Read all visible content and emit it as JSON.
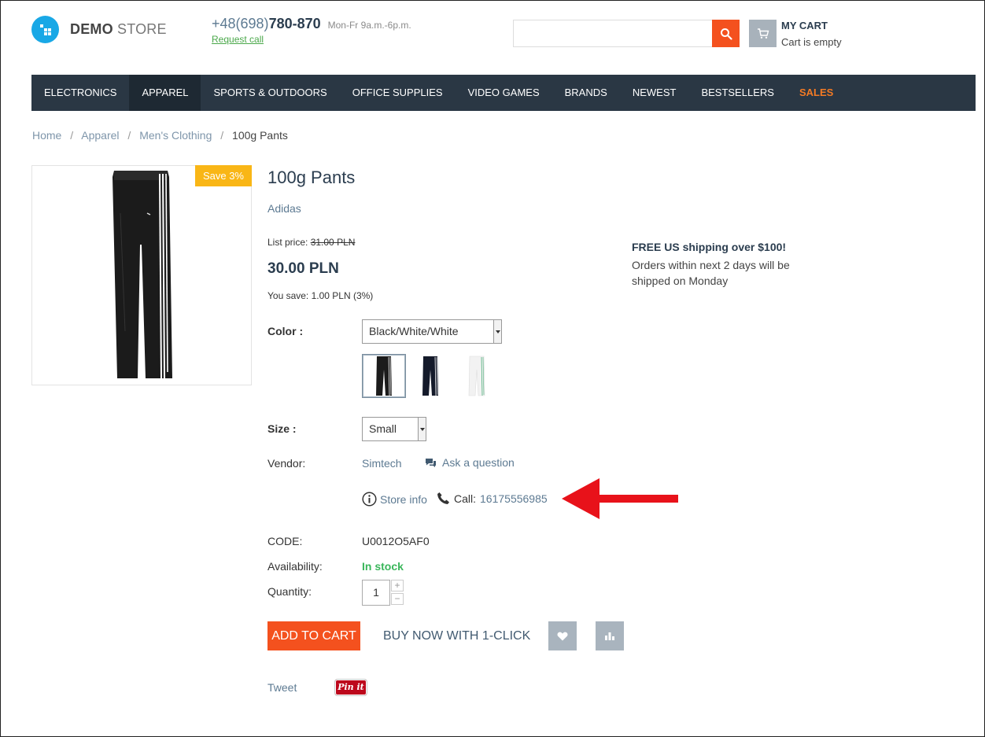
{
  "header": {
    "logo_bold": "DEMO",
    "logo_light": "STORE",
    "phone_code": "+48(698)",
    "phone_number": "780-870",
    "phone_hours": "Mon-Fr 9a.m.-6p.m.",
    "request_call": "Request call",
    "search_placeholder": "",
    "cart_title": "MY CART",
    "cart_status": "Cart is empty"
  },
  "nav": {
    "items": [
      {
        "label": "ELECTRONICS"
      },
      {
        "label": "APPAREL"
      },
      {
        "label": "SPORTS & OUTDOORS"
      },
      {
        "label": "OFFICE SUPPLIES"
      },
      {
        "label": "VIDEO GAMES"
      },
      {
        "label": "BRANDS"
      },
      {
        "label": "NEWEST"
      },
      {
        "label": "BESTSELLERS"
      },
      {
        "label": "SALES"
      }
    ],
    "active_index": 1
  },
  "breadcrumb": {
    "items": [
      "Home",
      "Apparel",
      "Men's Clothing"
    ],
    "current": "100g Pants",
    "separator": "/"
  },
  "product": {
    "badge": "Save 3%",
    "title": "100g Pants",
    "brand": "Adidas",
    "list_price_label": "List price:",
    "list_price": "31.00 PLN",
    "price": "30.00 PLN",
    "you_save": "You save: 1.00 PLN (3%)",
    "color_label": "Color :",
    "color_value": "Black/White/White",
    "size_label": "Size :",
    "size_value": "Small",
    "vendor_label": "Vendor:",
    "vendor_value": "Simtech",
    "ask_question": "Ask a question",
    "store_info": "Store info",
    "call_label": "Call:",
    "call_number": "16175556985",
    "code_label": "CODE:",
    "code_value": "U0012O5AF0",
    "availability_label": "Availability:",
    "availability_value": "In stock",
    "quantity_label": "Quantity:",
    "quantity_value": "1",
    "qty_plus": "+",
    "qty_minus": "−",
    "add_to_cart": "ADD TO CART",
    "buy_now": "BUY NOW WITH 1-CLICK"
  },
  "shipping": {
    "title": "FREE US shipping over $100!",
    "text": "Orders within next 2 days will be shipped on Monday"
  },
  "social": {
    "tweet": "Tweet",
    "pinit": "Pin it"
  },
  "colors": {
    "accent": "#f4511e",
    "nav_bg": "#2a3744",
    "sales": "#f37a24",
    "in_stock": "#3ab65b",
    "badge": "#f9b616",
    "annotation": "#e8121a"
  }
}
